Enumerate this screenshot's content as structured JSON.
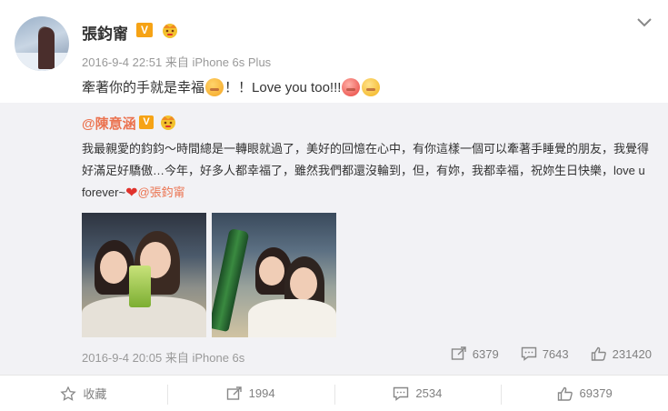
{
  "post": {
    "author": "張鈞甯",
    "verified_badge": "V",
    "timestamp": "2016-9-4 22:51",
    "source_prefix": "来自",
    "source": "iPhone 6s Plus",
    "content_text": "牽著你的手就是幸福",
    "content_text2": "！！Love you too!!!",
    "icons": {
      "expand": "chevron-down-icon",
      "badge": "member-crown-icon"
    }
  },
  "repost": {
    "author": "@陳意涵",
    "verified_badge": "V",
    "text": "我最親愛的鈞鈞～時間總是一轉眼就過了，美好的回憶在心中，有你這樣一個可以牽著手睡覺的朋友，我覺得好滿足好驕傲…今年，好多人都幸福了，雖然我們都還沒輪到，但，有妳，我都幸福，祝妳生日快樂，love u forever~",
    "heart": "❤",
    "mention": "@張鈞甯",
    "timestamp": "2016-9-4 20:05",
    "source_prefix": "来自",
    "source": "iPhone 6s",
    "stats": {
      "reposts": "6379",
      "comments": "7643",
      "likes": "231420"
    }
  },
  "actions": {
    "favorite": "收藏",
    "repost": "1994",
    "comment": "2534",
    "like": "69379"
  },
  "colors": {
    "link": "#eb7350",
    "badge": "#f6a315",
    "muted": "#999999",
    "repost_bg": "#f2f2f5"
  }
}
